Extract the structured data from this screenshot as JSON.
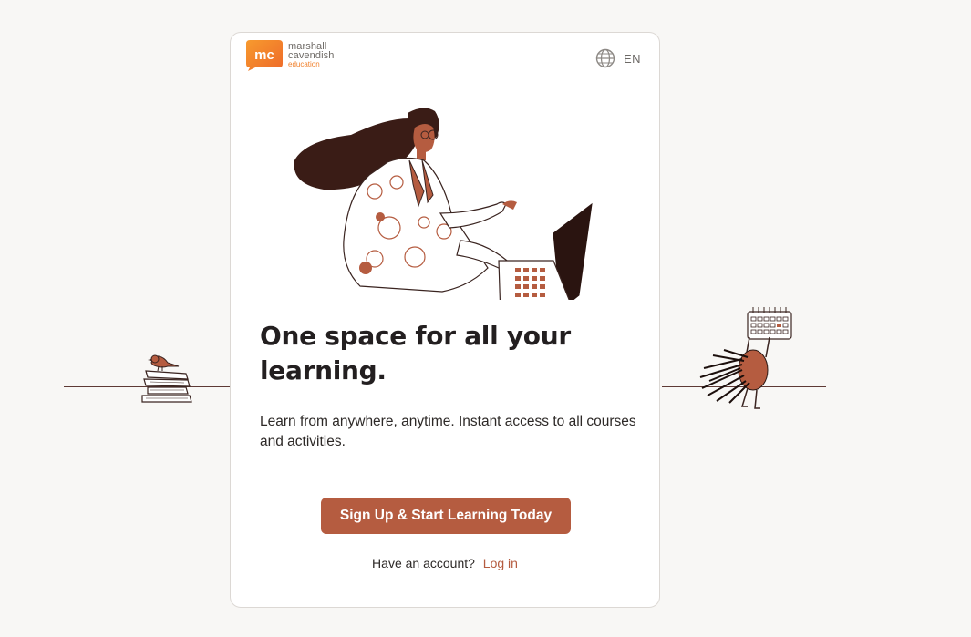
{
  "brand": {
    "mark": "mc",
    "line1": "marshall",
    "line2": "cavendish",
    "line3": "education",
    "color": "#f07f2a"
  },
  "language": {
    "code": "EN",
    "icon": "globe-icon"
  },
  "hero": {
    "title": "One space for all your learning.",
    "description": "Learn from anywhere, anytime. Instant access to all courses and activities."
  },
  "cta": {
    "label": "Sign Up & Start Learning Today",
    "color": "#b55c40"
  },
  "account": {
    "prompt": "Have an account?",
    "login_label": "Log in"
  },
  "decorations": [
    "books-with-bird-illustration",
    "calendar-character-illustration",
    "woman-with-laptop-illustration"
  ]
}
